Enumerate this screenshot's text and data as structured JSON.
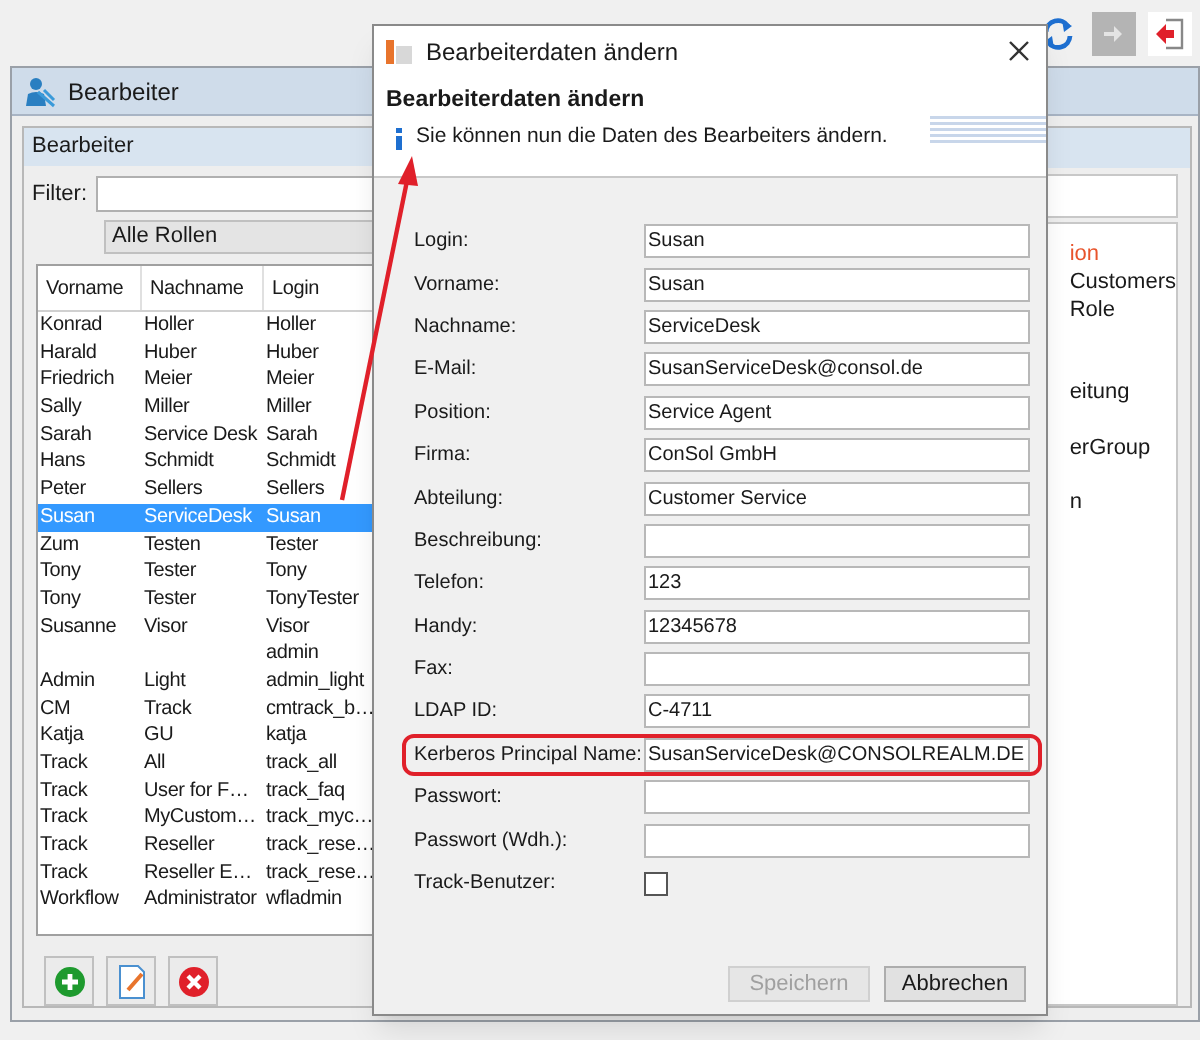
{
  "window": {
    "title": "Bearbeiter"
  },
  "panel": {
    "title": "Bearbeiter",
    "filter_label": "Filter:",
    "role_select": "Alle Rollen"
  },
  "table": {
    "columns": [
      "Vorname",
      "Nachname",
      "Login"
    ],
    "rows": [
      {
        "vorname": "Konrad",
        "nachname": "Holler",
        "login": "Holler",
        "selected": false
      },
      {
        "vorname": "Harald",
        "nachname": "Huber",
        "login": "Huber",
        "selected": false
      },
      {
        "vorname": "Friedrich",
        "nachname": "Meier",
        "login": "Meier",
        "selected": false
      },
      {
        "vorname": "Sally",
        "nachname": "Miller",
        "login": "Miller",
        "selected": false
      },
      {
        "vorname": "Sarah",
        "nachname": "Service Desk",
        "login": "Sarah",
        "selected": false
      },
      {
        "vorname": "Hans",
        "nachname": "Schmidt",
        "login": "Schmidt",
        "selected": false
      },
      {
        "vorname": "Peter",
        "nachname": "Sellers",
        "login": "Sellers",
        "selected": false
      },
      {
        "vorname": "Susan",
        "nachname": "ServiceDesk",
        "login": "Susan",
        "selected": true
      },
      {
        "vorname": "Zum",
        "nachname": "Testen",
        "login": "Tester",
        "selected": false
      },
      {
        "vorname": "Tony",
        "nachname": "Tester",
        "login": "Tony",
        "selected": false
      },
      {
        "vorname": "Tony",
        "nachname": "Tester",
        "login": "TonyTester",
        "selected": false
      },
      {
        "vorname": "Susanne",
        "nachname": "Visor",
        "login": "Visor",
        "selected": false
      },
      {
        "login": "admin",
        "selected": false
      },
      {
        "vorname": "Admin",
        "nachname": "Light",
        "login": "admin_light",
        "selected": false
      },
      {
        "vorname": "CM",
        "nachname": "Track",
        "login": "cmtrack_b…",
        "selected": false
      },
      {
        "vorname": "Katja",
        "nachname": "GU",
        "login": "katja",
        "selected": false
      },
      {
        "vorname": "Track",
        "nachname": "All",
        "login": "track_all",
        "selected": false
      },
      {
        "vorname": "Track",
        "nachname": "User for F…",
        "login": "track_faq",
        "selected": false
      },
      {
        "vorname": "Track",
        "nachname": "MyCustom…",
        "login": "track_myc…",
        "selected": false
      },
      {
        "vorname": "Track",
        "nachname": "Reseller",
        "login": "track_rese…",
        "selected": false
      },
      {
        "vorname": "Track",
        "nachname": "Reseller E…",
        "login": "track_rese…",
        "selected": false
      },
      {
        "vorname": "Workflow",
        "nachname": "Administrator",
        "login": "wfladmin",
        "selected": false
      }
    ]
  },
  "right_list": [
    {
      "text": "ion",
      "color": "#e8542c"
    },
    {
      "text": "Customers",
      "color": "#1a1a1a"
    },
    {
      "text": "Role",
      "color": "#1a1a1a"
    },
    {
      "text": "eitung",
      "color": "#1a1a1a"
    },
    {
      "text": "erGroup",
      "color": "#1a1a1a"
    },
    {
      "text": "n",
      "color": "#1a1a1a"
    }
  ],
  "dialog": {
    "title": "Bearbeiterdaten ändern",
    "heading": "Bearbeiterdaten ändern",
    "info": "Sie können nun die Daten des Bearbeiters ändern.",
    "fields": [
      {
        "kind": "text",
        "label": "Login:",
        "value": "Susan",
        "highlighted": false
      },
      {
        "kind": "text",
        "label": "Vorname:",
        "value": "Susan",
        "highlighted": false
      },
      {
        "kind": "text",
        "label": "Nachname:",
        "value": "ServiceDesk",
        "highlighted": false
      },
      {
        "kind": "text",
        "label": "E-Mail:",
        "value": "SusanServiceDesk@consol.de",
        "highlighted": false
      },
      {
        "kind": "text",
        "label": "Position:",
        "value": "Service Agent",
        "highlighted": false
      },
      {
        "kind": "text",
        "label": "Firma:",
        "value": "ConSol GmbH",
        "highlighted": false
      },
      {
        "kind": "text",
        "label": "Abteilung:",
        "value": "Customer Service",
        "highlighted": false
      },
      {
        "kind": "text",
        "label": "Beschreibung:",
        "highlighted": false
      },
      {
        "kind": "text",
        "label": "Telefon:",
        "value": "123",
        "highlighted": false
      },
      {
        "kind": "text",
        "label": "Handy:",
        "value": "12345678",
        "highlighted": false
      },
      {
        "kind": "text",
        "label": "Fax:",
        "highlighted": false
      },
      {
        "kind": "text",
        "label": "LDAP ID:",
        "value": "C-4711",
        "highlighted": false
      },
      {
        "kind": "text",
        "label": "Kerberos Principal Name:",
        "value": "SusanServiceDesk@CONSOLREALM.DE",
        "highlighted": true
      },
      {
        "kind": "text",
        "label": "Passwort:",
        "highlighted": false
      },
      {
        "kind": "text",
        "label": "Passwort (Wdh.):",
        "highlighted": false
      },
      {
        "kind": "checkbox",
        "label": "Track-Benutzer:",
        "checked": false,
        "highlighted": false
      }
    ],
    "buttons": [
      {
        "label": "Speichern",
        "disabled": true
      },
      {
        "label": "Abbrechen",
        "disabled": false
      }
    ]
  }
}
